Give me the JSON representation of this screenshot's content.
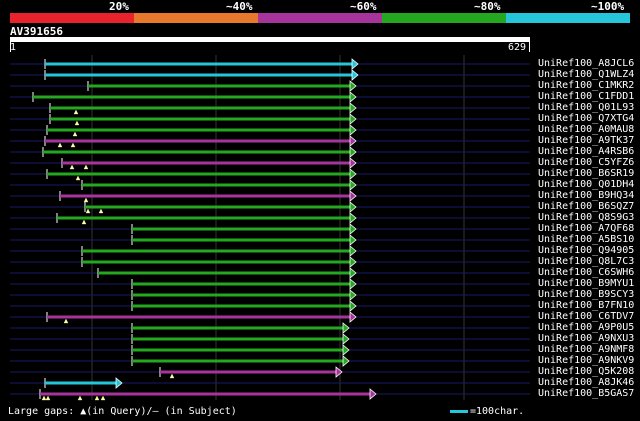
{
  "legend": [
    {
      "label": "20%",
      "color": "#e8232b"
    },
    {
      "label": "~40%",
      "color": "#e8782b"
    },
    {
      "label": "~60%",
      "color": "#a7349d"
    },
    {
      "label": "~80%",
      "color": "#24a81f"
    },
    {
      "label": "~100%",
      "color": "#26c6da"
    }
  ],
  "query": {
    "id": "AV391656",
    "start": "1",
    "end": "629"
  },
  "hits": [
    {
      "name": "UniRef100_A8JCL6",
      "start": 45,
      "end": 357,
      "color": "#26c6da",
      "gaps": []
    },
    {
      "name": "UniRef100_Q1WLZ4",
      "start": 45,
      "end": 357,
      "color": "#26c6da",
      "gaps": []
    },
    {
      "name": "UniRef100_C1MKR2",
      "start": 88,
      "end": 355,
      "color": "#24a81f",
      "gaps": []
    },
    {
      "name": "UniRef100_C1FDD1",
      "start": 33,
      "end": 355,
      "color": "#24a81f",
      "gaps": []
    },
    {
      "name": "UniRef100_Q01L93",
      "start": 50,
      "end": 355,
      "color": "#24a81f",
      "gaps": [
        76
      ]
    },
    {
      "name": "UniRef100_Q7XTG4",
      "start": 50,
      "end": 355,
      "color": "#24a81f",
      "gaps": [
        77
      ]
    },
    {
      "name": "UniRef100_A0MAU8",
      "start": 47,
      "end": 355,
      "color": "#24a81f",
      "gaps": [
        75
      ]
    },
    {
      "name": "UniRef100_A9TK37",
      "start": 45,
      "end": 355,
      "color": "#a7349d",
      "gaps": [
        60,
        73
      ]
    },
    {
      "name": "UniRef100_A4RSB6",
      "start": 43,
      "end": 355,
      "color": "#24a81f",
      "gaps": []
    },
    {
      "name": "UniRef100_C5YFZ6",
      "start": 62,
      "end": 355,
      "color": "#a7349d",
      "gaps": [
        72,
        86
      ]
    },
    {
      "name": "UniRef100_B6SR19",
      "start": 47,
      "end": 355,
      "color": "#24a81f",
      "gaps": [
        78
      ]
    },
    {
      "name": "UniRef100_Q01DH4",
      "start": 82,
      "end": 355,
      "color": "#24a81f",
      "gaps": []
    },
    {
      "name": "UniRef100_B9HQ34",
      "start": 60,
      "end": 355,
      "color": "#a7349d",
      "gaps": [
        86
      ]
    },
    {
      "name": "UniRef100_B6SQZ7",
      "start": 85,
      "end": 355,
      "color": "#24a81f",
      "gaps": [
        88,
        101
      ]
    },
    {
      "name": "UniRef100_Q8S9G3",
      "start": 57,
      "end": 355,
      "color": "#24a81f",
      "gaps": [
        84
      ]
    },
    {
      "name": "UniRef100_A7QF68",
      "start": 132,
      "end": 355,
      "color": "#24a81f",
      "gaps": []
    },
    {
      "name": "UniRef100_A5BS10",
      "start": 132,
      "end": 355,
      "color": "#24a81f",
      "gaps": []
    },
    {
      "name": "UniRef100_Q94905",
      "start": 82,
      "end": 355,
      "color": "#24a81f",
      "gaps": []
    },
    {
      "name": "UniRef100_Q8L7C3",
      "start": 82,
      "end": 355,
      "color": "#24a81f",
      "gaps": []
    },
    {
      "name": "UniRef100_C6SWH6",
      "start": 98,
      "end": 355,
      "color": "#24a81f",
      "gaps": []
    },
    {
      "name": "UniRef100_B9MYU1",
      "start": 132,
      "end": 355,
      "color": "#24a81f",
      "gaps": []
    },
    {
      "name": "UniRef100_B9SCY3",
      "start": 132,
      "end": 355,
      "color": "#24a81f",
      "gaps": []
    },
    {
      "name": "UniRef100_B7FN10",
      "start": 132,
      "end": 355,
      "color": "#24a81f",
      "gaps": []
    },
    {
      "name": "UniRef100_C6TDV7",
      "start": 47,
      "end": 355,
      "color": "#a7349d",
      "gaps": [
        66
      ]
    },
    {
      "name": "UniRef100_A9P0U5",
      "start": 132,
      "end": 348,
      "color": "#24a81f",
      "gaps": []
    },
    {
      "name": "UniRef100_A9NXU3",
      "start": 132,
      "end": 348,
      "color": "#24a81f",
      "gaps": []
    },
    {
      "name": "UniRef100_A9NMF8",
      "start": 132,
      "end": 348,
      "color": "#24a81f",
      "gaps": []
    },
    {
      "name": "UniRef100_A9NKV9",
      "start": 132,
      "end": 348,
      "color": "#24a81f",
      "gaps": []
    },
    {
      "name": "UniRef100_Q5K208",
      "start": 160,
      "end": 341,
      "color": "#a7349d",
      "gaps": [
        172
      ]
    },
    {
      "name": "UniRef100_A8JK46",
      "start": 45,
      "end": 121,
      "color": "#26c6da",
      "gaps": []
    },
    {
      "name": "UniRef100_B5GAS7",
      "start": 40,
      "end": 375,
      "color": "#a7349d",
      "gaps": [
        44,
        48,
        80,
        97,
        103
      ]
    }
  ],
  "footer": {
    "text": "Large gaps: ▲(in Query)/– (in Subject)"
  },
  "scale": {
    "text": "=100char."
  }
}
